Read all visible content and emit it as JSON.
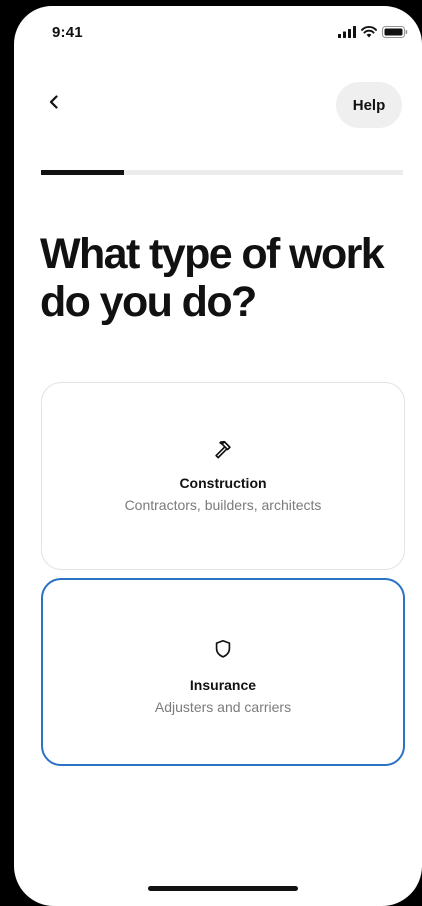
{
  "status_bar": {
    "time": "9:41",
    "icons": [
      "signal-icon",
      "wifi-icon",
      "battery-icon"
    ]
  },
  "nav": {
    "back_icon": "chevron-left-icon",
    "help_label": "Help"
  },
  "progress": {
    "fraction": 0.23
  },
  "page": {
    "title": "What type of work do you do?"
  },
  "options": [
    {
      "icon": "hammer-icon",
      "title": "Construction",
      "subtitle": "Contractors, builders, architects",
      "selected": false
    },
    {
      "icon": "shield-icon",
      "title": "Insurance",
      "subtitle": "Adjusters and carriers",
      "selected": true
    }
  ],
  "colors": {
    "selected_border": "#2a72c4",
    "text_primary": "#111111",
    "text_secondary": "#7b7b7b",
    "progress_track": "#ececec"
  }
}
